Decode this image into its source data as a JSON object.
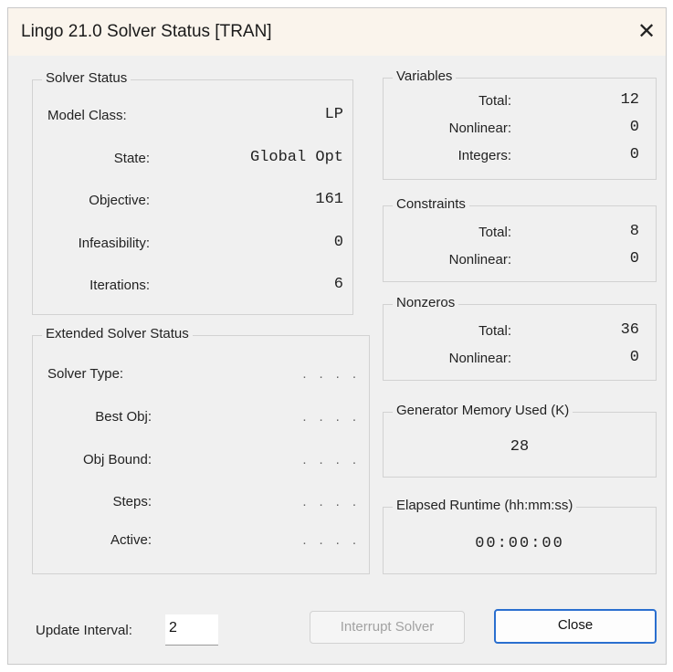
{
  "window": {
    "title": "Lingo 21.0 Solver Status [TRAN]",
    "close_glyph": "✕"
  },
  "solver_status": {
    "title": "Solver Status",
    "rows": [
      {
        "label": "Model Class:",
        "value": "LP"
      },
      {
        "label": "State:",
        "value": "Global Opt"
      },
      {
        "label": "Objective:",
        "value": "161"
      },
      {
        "label": "Infeasibility:",
        "value": "0"
      },
      {
        "label": "Iterations:",
        "value": "6"
      }
    ]
  },
  "extended_status": {
    "title": "Extended Solver Status",
    "rows": [
      {
        "label": "Solver Type:",
        "value": "...."
      },
      {
        "label": "Best Obj:",
        "value": "...."
      },
      {
        "label": "Obj Bound:",
        "value": "...."
      },
      {
        "label": "Steps:",
        "value": "...."
      },
      {
        "label": "Active:",
        "value": "...."
      }
    ]
  },
  "variables": {
    "title": "Variables",
    "rows": [
      {
        "label": "Total:",
        "value": "12"
      },
      {
        "label": "Nonlinear:",
        "value": "0"
      },
      {
        "label": "Integers:",
        "value": "0"
      }
    ]
  },
  "constraints": {
    "title": "Constraints",
    "rows": [
      {
        "label": "Total:",
        "value": "8"
      },
      {
        "label": "Nonlinear:",
        "value": "0"
      }
    ]
  },
  "nonzeros": {
    "title": "Nonzeros",
    "rows": [
      {
        "label": "Total:",
        "value": "36"
      },
      {
        "label": "Nonlinear:",
        "value": "0"
      }
    ]
  },
  "memory": {
    "title": "Generator Memory Used (K)",
    "value": "28"
  },
  "runtime": {
    "title": "Elapsed Runtime (hh:mm:ss)",
    "value": "00:00:00"
  },
  "footer": {
    "update_interval_label": "Update Interval:",
    "update_interval_value": "2",
    "interrupt_label": "Interrupt Solver",
    "close_label": "Close"
  },
  "colors": {
    "accent": "#2a6fcf",
    "title_bg": "#faf4ec",
    "dialog_bg": "#f0f0f0"
  }
}
